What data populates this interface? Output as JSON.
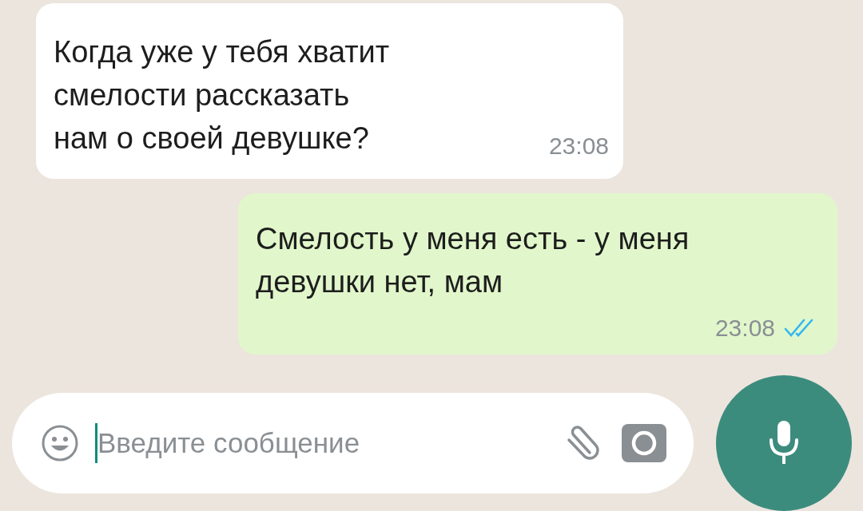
{
  "messages": [
    {
      "kind": "incoming",
      "text": "Когда уже у тебя хватит\nсмелости рассказать\nнам о своей девушке?",
      "time": "23:08"
    },
    {
      "kind": "outgoing",
      "text": "Смелость у меня есть - у меня\nдевушки нет, мам",
      "time": "23:08",
      "read": true
    }
  ],
  "composer": {
    "placeholder": "Введите сообщение"
  }
}
